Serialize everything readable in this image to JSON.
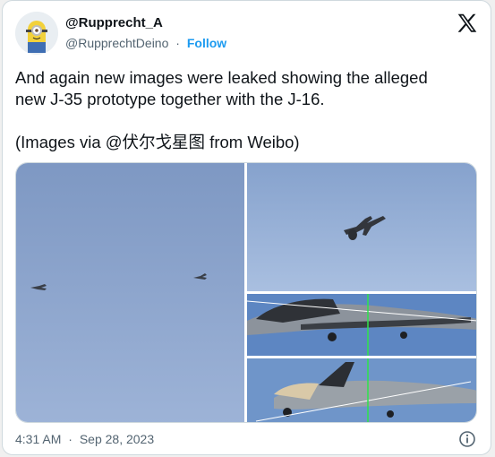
{
  "author": {
    "name": "@Rupprecht_A",
    "handle": "@RupprechtDeino",
    "separator": "·",
    "follow_label": "Follow"
  },
  "tweet": {
    "line1": "And again new images were leaked showing the alleged",
    "line2": "new J-35 prototype together with the J-16.",
    "line3": "(Images via @伏尔戈星图 from Weibo)"
  },
  "meta": {
    "time": "4:31 AM",
    "separator": "·",
    "date": "Sep 28, 2023"
  },
  "icons": {
    "platform": "x-logo-icon",
    "info": "info-icon",
    "avatar": "minion-avatar"
  },
  "colors": {
    "follow": "#1d9bf0",
    "secondary_text": "#536471",
    "border": "#cfd9de",
    "sky": "#8ba6cf"
  }
}
